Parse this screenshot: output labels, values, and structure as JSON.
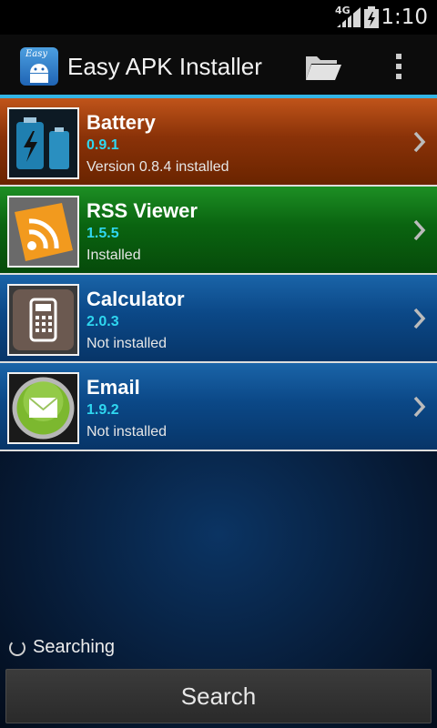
{
  "status_bar": {
    "network": "4G",
    "time": "1:10",
    "icons": [
      "signal-icon",
      "battery-icon"
    ]
  },
  "action_bar": {
    "title": "Easy APK Installer",
    "app_icon_text": "Easy",
    "icons": [
      "folder-icon",
      "overflow-menu-icon"
    ]
  },
  "apps": [
    {
      "name": "Battery",
      "version": "0.9.1",
      "status": "Version 0.8.4 installed",
      "color": "#8a3208",
      "icon": "battery-app-icon"
    },
    {
      "name": "RSS Viewer",
      "version": "1.5.5",
      "status": "Installed",
      "color": "#0a6410",
      "icon": "rss-app-icon"
    },
    {
      "name": "Calculator",
      "version": "2.0.3",
      "status": "Not installed",
      "color": "#0b4887",
      "icon": "calculator-app-icon"
    },
    {
      "name": "Email",
      "version": "1.9.2",
      "status": "Not installed",
      "color": "#0b4887",
      "icon": "email-app-icon"
    }
  ],
  "footer": {
    "searching_label": "Searching",
    "search_button_label": "Search"
  },
  "colors": {
    "accent": "#33b5e5",
    "version_text": "#2fd7f0"
  }
}
